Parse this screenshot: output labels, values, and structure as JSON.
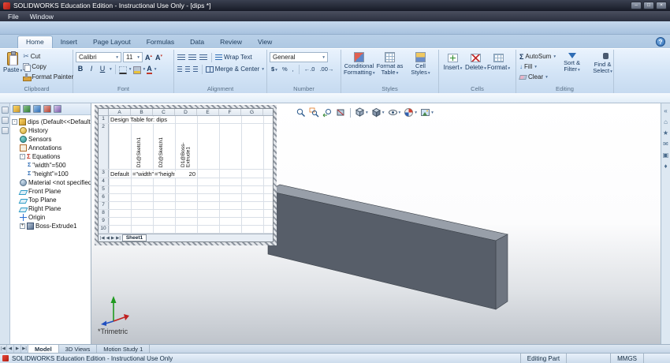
{
  "icons": {
    "chevron": "▾",
    "up": "▴",
    "help": "?",
    "scissors": "✂",
    "sigma": "Σ",
    "arrow_down": "↓",
    "taskpane": [
      "«",
      "⌂",
      "★",
      "✉",
      "▣",
      "♦"
    ]
  },
  "titlebar": {
    "title": "SOLIDWORKS Education Edition - Instructional Use Only - [dips *]",
    "minimize": "–",
    "maximize": "□",
    "close": "×"
  },
  "menubar": {
    "items": [
      "File",
      "Window"
    ]
  },
  "ribbon": {
    "tabs": [
      "Home",
      "Insert",
      "Page Layout",
      "Formulas",
      "Data",
      "Review",
      "View"
    ],
    "clipboard": {
      "group": "Clipboard",
      "paste": "Paste",
      "cut": "Cut",
      "copy": "Copy",
      "format_painter": "Format Painter"
    },
    "font": {
      "group": "Font",
      "family": "Calibri",
      "size": "11",
      "bold": "B",
      "italic": "I",
      "underline": "U",
      "grow": "A",
      "shrink": "A",
      "color_letter": "A"
    },
    "alignment": {
      "group": "Alignment",
      "wrap": "Wrap Text",
      "merge": "Merge & Center"
    },
    "number": {
      "group": "Number",
      "format": "General",
      "currency": "$",
      "percent": "%",
      "comma": ",",
      "increase": "←.0",
      "decrease": ".00→"
    },
    "styles": {
      "group": "Styles",
      "conditional": "Conditional Formatting",
      "format_table": "Format as Table",
      "cell_styles": "Cell Styles"
    },
    "cells": {
      "group": "Cells",
      "insert": "Insert",
      "delete": "Delete",
      "format": "Format"
    },
    "editing": {
      "group": "Editing",
      "autosum": "AutoSum",
      "fill": "Fill",
      "clear": "Clear",
      "sort": "Sort & Filter",
      "find": "Find & Select"
    }
  },
  "tree": {
    "root": "dips (Default<<Default>_D",
    "root_expand": "-",
    "items": [
      {
        "label": "History"
      },
      {
        "label": "Sensors"
      },
      {
        "label": "Annotations"
      },
      {
        "label": "Equations",
        "expand": "-"
      },
      {
        "label": "\"width\"=500"
      },
      {
        "label": "\"height\"=100"
      },
      {
        "label": "Material <not specified>"
      },
      {
        "label": "Front Plane"
      },
      {
        "label": "Top Plane"
      },
      {
        "label": "Right Plane"
      },
      {
        "label": "Origin"
      },
      {
        "label": "Boss-Extrude1",
        "expand": "+"
      }
    ]
  },
  "sheet": {
    "columns": [
      "A",
      "B",
      "C",
      "D",
      "E",
      "F",
      "G"
    ],
    "rows": [
      "1",
      "2",
      "3",
      "4",
      "5",
      "6",
      "7",
      "8",
      "9",
      "10"
    ],
    "title": "Design Table for: dips",
    "headers": [
      "D1@Sketch1",
      "D2@Sketch1",
      "D1@Boss-Extrude1"
    ],
    "config_name": "Default",
    "values": [
      "=\"width\"",
      "=\"height\"",
      "20"
    ],
    "tab": "Sheet1",
    "nav": [
      "|◀",
      "◀",
      "▶",
      "▶|"
    ]
  },
  "viewport": {
    "view_label": "*Trimetric"
  },
  "bottom_tabs": {
    "nav": [
      "|◀",
      "◀",
      "▶",
      "▶|"
    ],
    "tabs": [
      "Model",
      "3D Views",
      "Motion Study 1"
    ]
  },
  "statusbar": {
    "left": "SOLIDWORKS Education Edition - Instructional Use Only",
    "mode": "Editing Part",
    "units": "MMGS"
  }
}
